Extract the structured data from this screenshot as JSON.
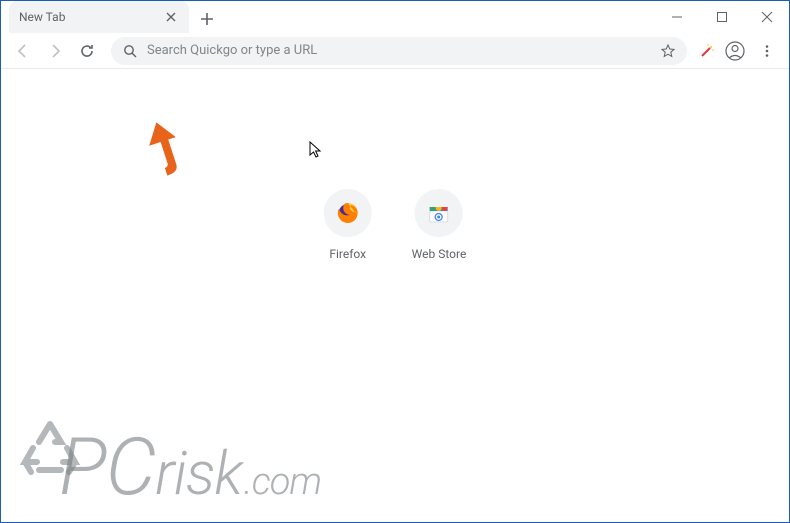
{
  "window": {
    "tab_title": "New Tab"
  },
  "omnibox": {
    "placeholder": "Search Quickgo or type a URL"
  },
  "shortcuts": [
    {
      "label": "Firefox"
    },
    {
      "label": "Web Store"
    }
  ],
  "watermark": {
    "text_prefix": "PC",
    "text_mid": "risk",
    "text_suffix": ".com"
  }
}
